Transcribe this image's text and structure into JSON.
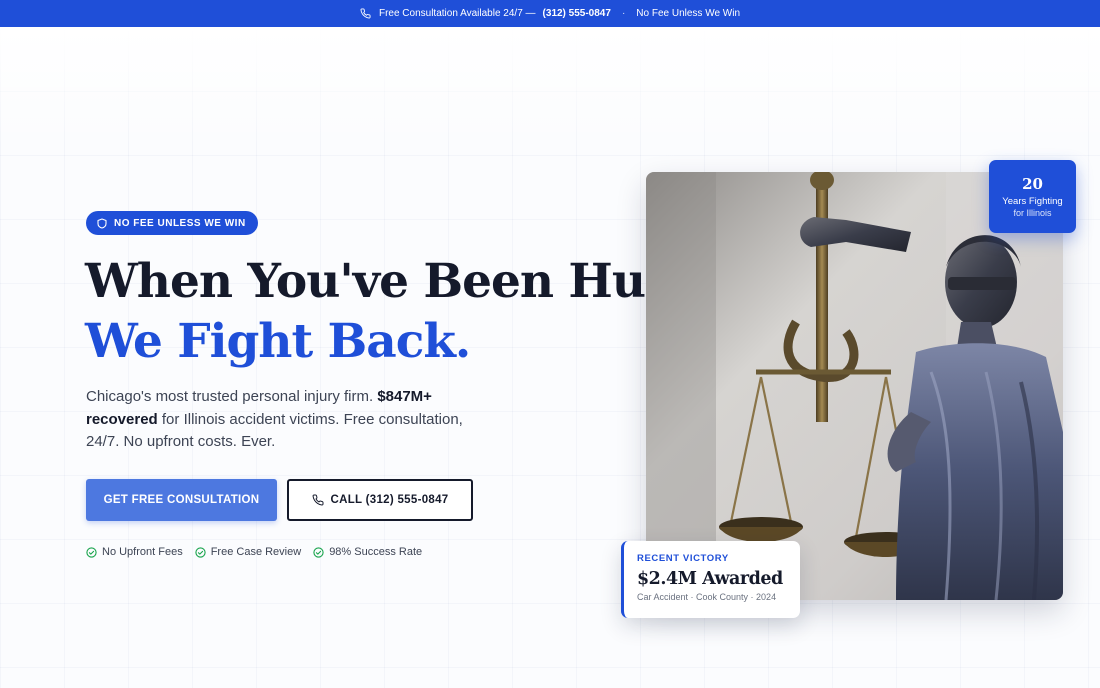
{
  "topbar": {
    "prefix": "Free Consultation Available 24/7 —",
    "phone": "(312) 555-0847",
    "separator": "·",
    "tagline": "No Fee Unless We Win"
  },
  "hero": {
    "badge": "NO FEE UNLESS WE WIN",
    "headline_line1": "When You've Been Hurt,",
    "headline_line2": "We Fight Back.",
    "lead_part1": "Chicago's most trusted personal injury firm.",
    "lead_bold": "$847M+ recovered",
    "lead_part2": "for Illinois accident victims. Free consultation, 24/7. No upfront costs. Ever.",
    "cta_primary": "GET FREE CONSULTATION",
    "cta_secondary": "CALL (312) 555-0847",
    "checks": [
      "No Upfront Fees",
      "Free Case Review",
      "98% Success Rate"
    ]
  },
  "years_card": {
    "number": "20",
    "line1": "Years Fighting",
    "line2": "for Illinois"
  },
  "victory_card": {
    "kicker": "RECENT VICTORY",
    "amount": "$2.4M Awarded",
    "details": "Car Accident · Cook County · 2024"
  },
  "colors": {
    "brand_blue": "#1f4fd8",
    "button_blue": "#4d78e0",
    "dark": "#151a2b",
    "check_green": "#16a34a"
  },
  "icons": {
    "topbar": "phone-icon",
    "badge": "shield-icon",
    "call_button": "phone-icon",
    "checks": "check-circle-icon"
  }
}
